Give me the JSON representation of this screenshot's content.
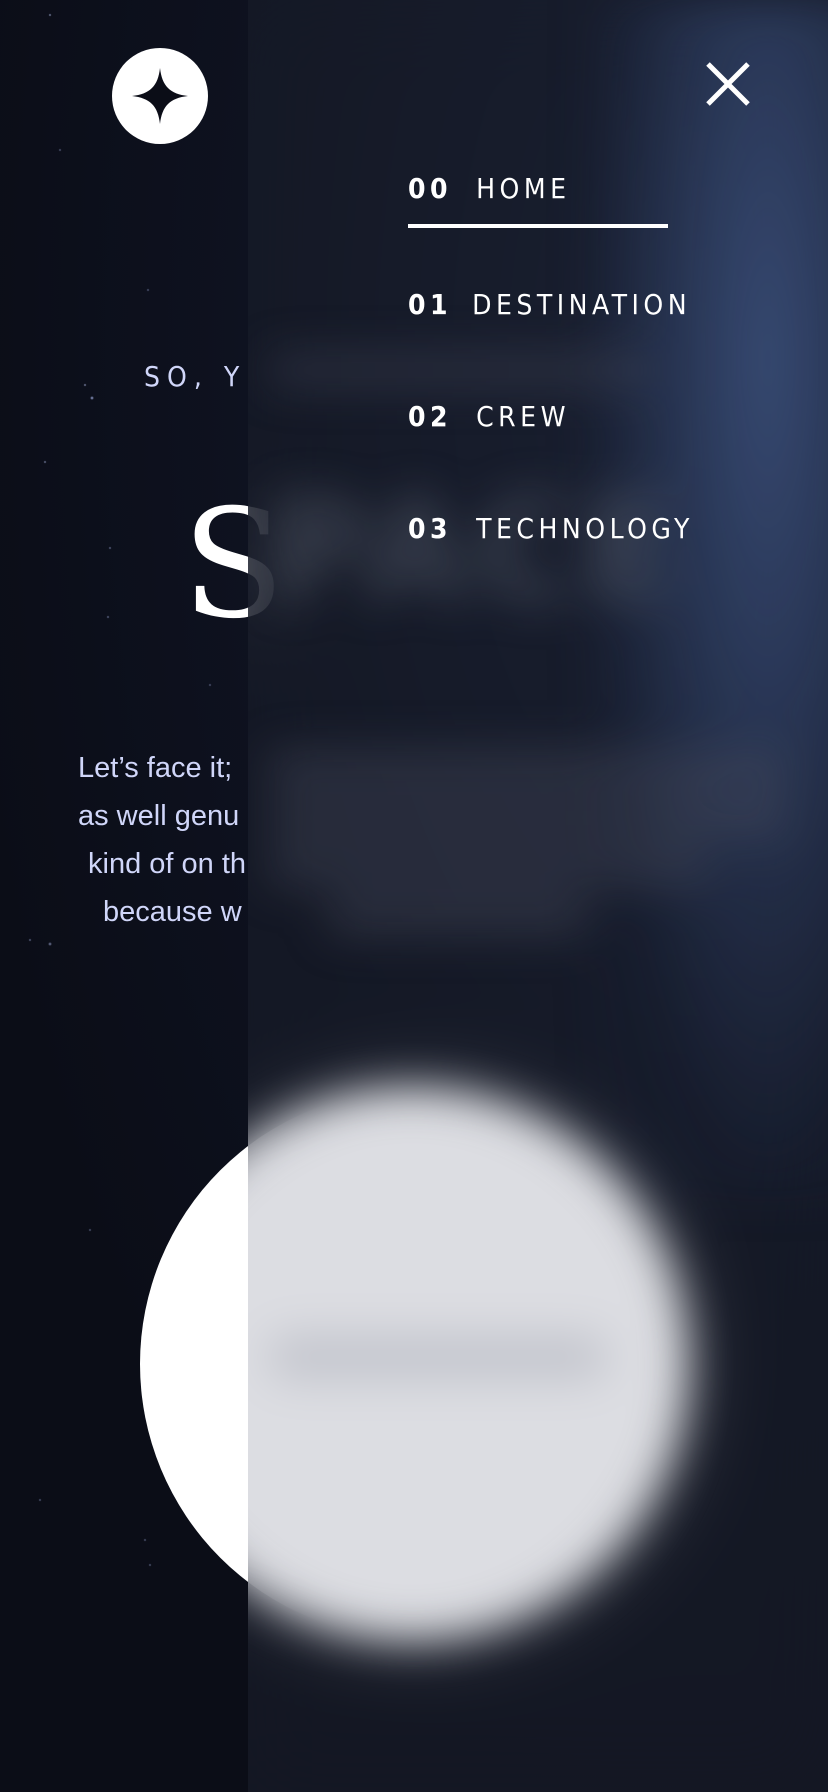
{
  "header": {
    "logo_icon": "four-point-star-icon",
    "close_icon": "close-icon"
  },
  "hero": {
    "eyebrow": "SO, Y",
    "title": "S",
    "intro_lines": [
      "Let’s face it;",
      "as well genu",
      "kind of on th",
      "because w"
    ],
    "explore_label": ""
  },
  "nav": {
    "items": [
      {
        "num": "00",
        "label": "HOME",
        "active": true
      },
      {
        "num": "01",
        "label": "DESTINATION",
        "active": false
      },
      {
        "num": "02",
        "label": "CREW",
        "active": false
      },
      {
        "num": "03",
        "label": "TECHNOLOGY",
        "active": false
      }
    ]
  },
  "colors": {
    "background": "#0b0d17",
    "panel": "#181c28",
    "text": "#ffffff",
    "muted_text": "#d0d6f9"
  }
}
